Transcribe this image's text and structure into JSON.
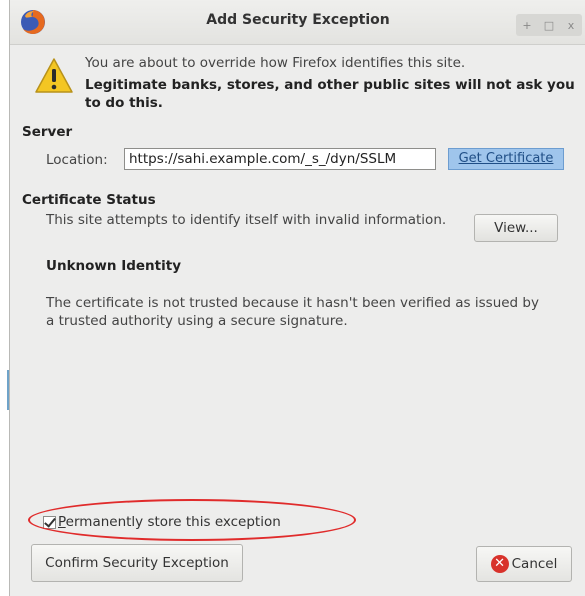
{
  "window": {
    "title": "Add Security Exception",
    "controls": [
      "+",
      "□",
      "x"
    ]
  },
  "header": {
    "intro": "You are about to override how Firefox identifies this site.",
    "warning": "Legitimate banks, stores, and other public sites will not ask you to do this."
  },
  "server": {
    "section_label": "Server",
    "location_label": "Location:",
    "location_value": "https://sahi.example.com/_s_/dyn/SSLM",
    "get_certificate_label": "Get Certificate"
  },
  "certificate_status": {
    "section_label": "Certificate Status",
    "description": "This site attempts to identify itself with invalid information.",
    "view_label": "View...",
    "identity_heading": "Unknown Identity",
    "detail": "The certificate is not trusted because it hasn't been verified as issued by a trusted authority using a secure signature."
  },
  "options": {
    "permanent_label": "Permanently store this exception",
    "permanent_checked": true
  },
  "actions": {
    "confirm_label": "Confirm Security Exception",
    "cancel_label": "Cancel"
  },
  "icons": {
    "app": "firefox-icon",
    "warning": "warning-icon",
    "cancel": "cancel-icon"
  },
  "colors": {
    "annotation": "#e02b2b",
    "get_certificate_bg": "#9fc5ec",
    "cancel_icon": "#d8322b"
  }
}
